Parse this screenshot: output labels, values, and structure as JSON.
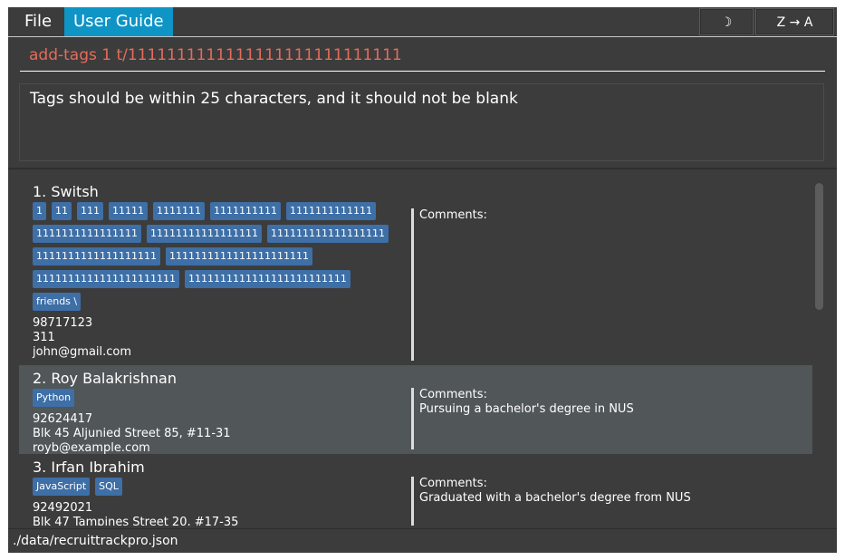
{
  "menu": {
    "file": "File",
    "user_guide": "User Guide"
  },
  "toolbar": {
    "theme_icon": "☽",
    "sort_label": "Z → A"
  },
  "command": {
    "value": "add-tags 1 t/1111111111111111111111111111"
  },
  "result": {
    "message": "Tags should be within 25 characters, and it should not be blank"
  },
  "contacts": [
    {
      "name": "1. Switsh",
      "tags": [
        "1",
        "11",
        "111",
        "11111",
        "1111111",
        "1111111111",
        "1111111111111",
        "1111111111111111",
        "11111111111111111",
        "111111111111111111",
        "1111111111111111111",
        "1111111111111111111111",
        "1111111111111111111111",
        "1111111111111111111111111",
        "friends \\"
      ],
      "phone": "98717123",
      "address": "311",
      "email": "john@gmail.com",
      "comments_label": "Comments:",
      "comments": ""
    },
    {
      "name": "2. Roy Balakrishnan",
      "tags": [
        "Python"
      ],
      "phone": "92624417",
      "address": "Blk 45 Aljunied Street 85, #11-31",
      "email": "royb@example.com",
      "comments_label": "Comments:",
      "comments": "Pursuing a bachelor's degree in NUS"
    },
    {
      "name": "3. Irfan Ibrahim",
      "tags": [
        "JavaScript",
        "SQL"
      ],
      "phone": "92492021",
      "address": "Blk 47 Tampines Street 20, #17-35",
      "email": "",
      "comments_label": "Comments:",
      "comments": "Graduated with a bachelor's degree from NUS"
    }
  ],
  "status": {
    "path": "./data/recruittrackpro.json"
  },
  "colors": {
    "accent": "#0f94c6",
    "tag": "#3e6fa6",
    "command_text": "#e56c5b",
    "selected_row": "#515658"
  }
}
